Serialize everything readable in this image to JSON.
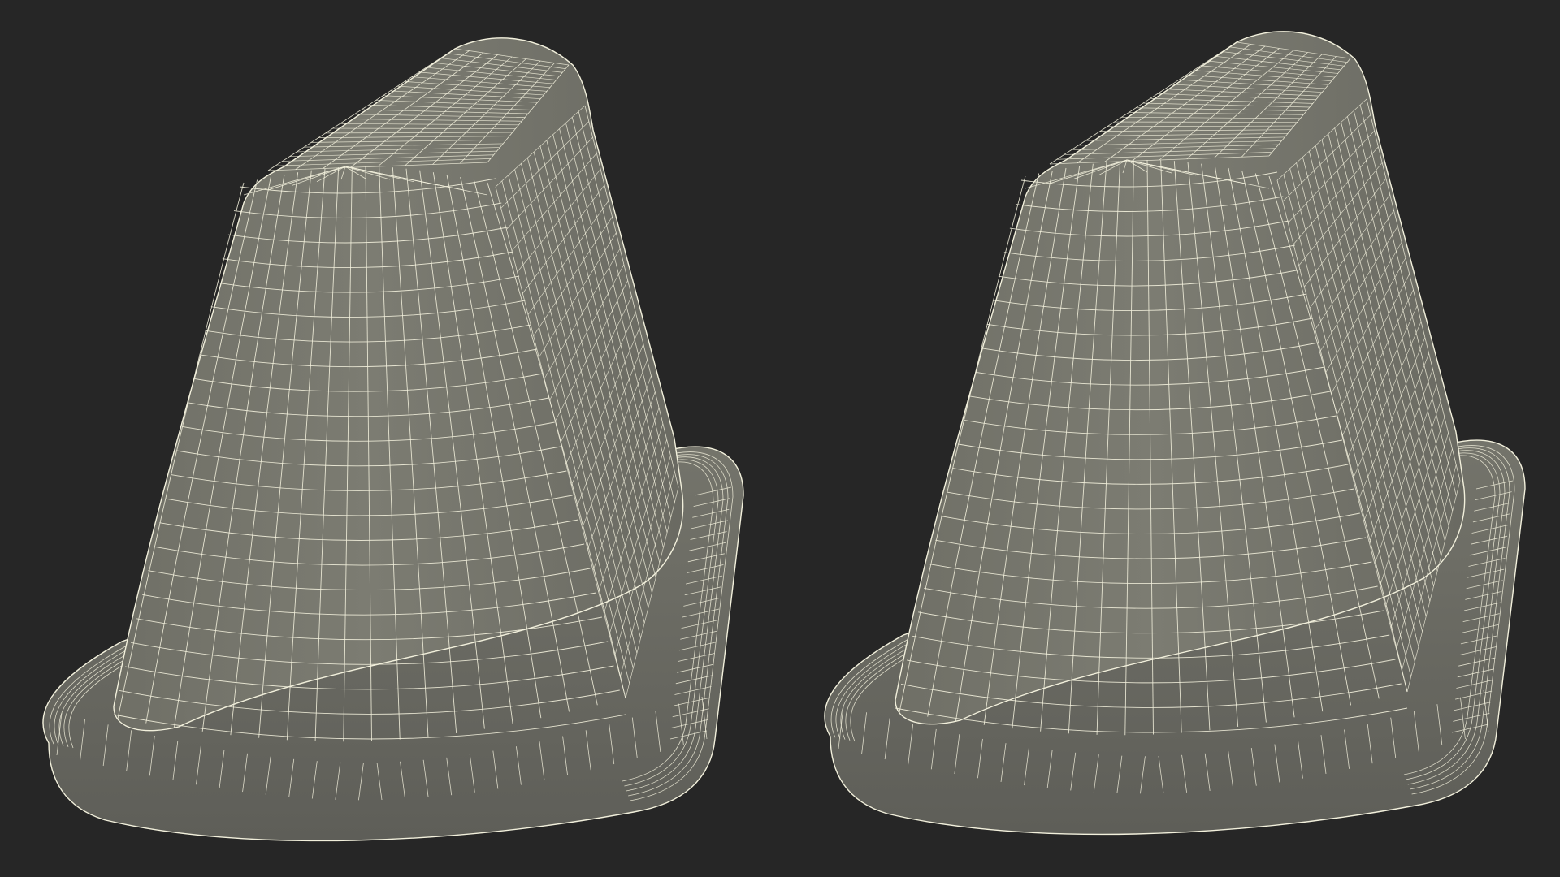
{
  "scene": {
    "background_color": "#262626",
    "surface_color": "#7a7a70",
    "surface_shadow_color": "#60605a",
    "wire_color": "#f2f0dc",
    "objects": [
      {
        "name": "cone-model-left",
        "view": "wireframe-shaded"
      },
      {
        "name": "cone-model-right",
        "view": "wireframe-shaded"
      }
    ]
  }
}
